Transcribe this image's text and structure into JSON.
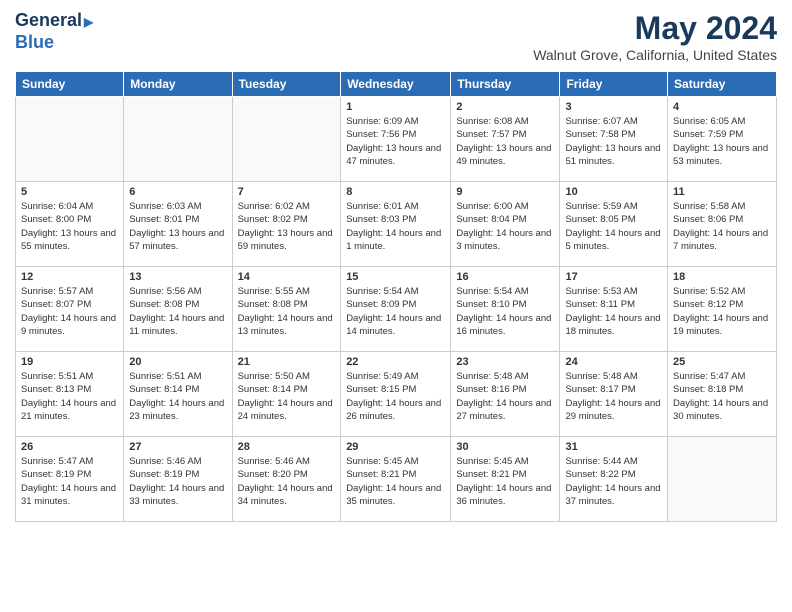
{
  "header": {
    "logo_line1": "General",
    "logo_line2": "Blue",
    "month": "May 2024",
    "location": "Walnut Grove, California, United States"
  },
  "days_of_week": [
    "Sunday",
    "Monday",
    "Tuesday",
    "Wednesday",
    "Thursday",
    "Friday",
    "Saturday"
  ],
  "weeks": [
    [
      {
        "day": "",
        "empty": true
      },
      {
        "day": "",
        "empty": true
      },
      {
        "day": "",
        "empty": true
      },
      {
        "day": "1",
        "sunrise": "6:09 AM",
        "sunset": "7:56 PM",
        "daylight": "13 hours and 47 minutes."
      },
      {
        "day": "2",
        "sunrise": "6:08 AM",
        "sunset": "7:57 PM",
        "daylight": "13 hours and 49 minutes."
      },
      {
        "day": "3",
        "sunrise": "6:07 AM",
        "sunset": "7:58 PM",
        "daylight": "13 hours and 51 minutes."
      },
      {
        "day": "4",
        "sunrise": "6:05 AM",
        "sunset": "7:59 PM",
        "daylight": "13 hours and 53 minutes."
      }
    ],
    [
      {
        "day": "5",
        "sunrise": "6:04 AM",
        "sunset": "8:00 PM",
        "daylight": "13 hours and 55 minutes."
      },
      {
        "day": "6",
        "sunrise": "6:03 AM",
        "sunset": "8:01 PM",
        "daylight": "13 hours and 57 minutes."
      },
      {
        "day": "7",
        "sunrise": "6:02 AM",
        "sunset": "8:02 PM",
        "daylight": "13 hours and 59 minutes."
      },
      {
        "day": "8",
        "sunrise": "6:01 AM",
        "sunset": "8:03 PM",
        "daylight": "14 hours and 1 minute."
      },
      {
        "day": "9",
        "sunrise": "6:00 AM",
        "sunset": "8:04 PM",
        "daylight": "14 hours and 3 minutes."
      },
      {
        "day": "10",
        "sunrise": "5:59 AM",
        "sunset": "8:05 PM",
        "daylight": "14 hours and 5 minutes."
      },
      {
        "day": "11",
        "sunrise": "5:58 AM",
        "sunset": "8:06 PM",
        "daylight": "14 hours and 7 minutes."
      }
    ],
    [
      {
        "day": "12",
        "sunrise": "5:57 AM",
        "sunset": "8:07 PM",
        "daylight": "14 hours and 9 minutes."
      },
      {
        "day": "13",
        "sunrise": "5:56 AM",
        "sunset": "8:08 PM",
        "daylight": "14 hours and 11 minutes."
      },
      {
        "day": "14",
        "sunrise": "5:55 AM",
        "sunset": "8:08 PM",
        "daylight": "14 hours and 13 minutes."
      },
      {
        "day": "15",
        "sunrise": "5:54 AM",
        "sunset": "8:09 PM",
        "daylight": "14 hours and 14 minutes."
      },
      {
        "day": "16",
        "sunrise": "5:54 AM",
        "sunset": "8:10 PM",
        "daylight": "14 hours and 16 minutes."
      },
      {
        "day": "17",
        "sunrise": "5:53 AM",
        "sunset": "8:11 PM",
        "daylight": "14 hours and 18 minutes."
      },
      {
        "day": "18",
        "sunrise": "5:52 AM",
        "sunset": "8:12 PM",
        "daylight": "14 hours and 19 minutes."
      }
    ],
    [
      {
        "day": "19",
        "sunrise": "5:51 AM",
        "sunset": "8:13 PM",
        "daylight": "14 hours and 21 minutes."
      },
      {
        "day": "20",
        "sunrise": "5:51 AM",
        "sunset": "8:14 PM",
        "daylight": "14 hours and 23 minutes."
      },
      {
        "day": "21",
        "sunrise": "5:50 AM",
        "sunset": "8:14 PM",
        "daylight": "14 hours and 24 minutes."
      },
      {
        "day": "22",
        "sunrise": "5:49 AM",
        "sunset": "8:15 PM",
        "daylight": "14 hours and 26 minutes."
      },
      {
        "day": "23",
        "sunrise": "5:48 AM",
        "sunset": "8:16 PM",
        "daylight": "14 hours and 27 minutes."
      },
      {
        "day": "24",
        "sunrise": "5:48 AM",
        "sunset": "8:17 PM",
        "daylight": "14 hours and 29 minutes."
      },
      {
        "day": "25",
        "sunrise": "5:47 AM",
        "sunset": "8:18 PM",
        "daylight": "14 hours and 30 minutes."
      }
    ],
    [
      {
        "day": "26",
        "sunrise": "5:47 AM",
        "sunset": "8:19 PM",
        "daylight": "14 hours and 31 minutes."
      },
      {
        "day": "27",
        "sunrise": "5:46 AM",
        "sunset": "8:19 PM",
        "daylight": "14 hours and 33 minutes."
      },
      {
        "day": "28",
        "sunrise": "5:46 AM",
        "sunset": "8:20 PM",
        "daylight": "14 hours and 34 minutes."
      },
      {
        "day": "29",
        "sunrise": "5:45 AM",
        "sunset": "8:21 PM",
        "daylight": "14 hours and 35 minutes."
      },
      {
        "day": "30",
        "sunrise": "5:45 AM",
        "sunset": "8:21 PM",
        "daylight": "14 hours and 36 minutes."
      },
      {
        "day": "31",
        "sunrise": "5:44 AM",
        "sunset": "8:22 PM",
        "daylight": "14 hours and 37 minutes."
      },
      {
        "day": "",
        "empty": true
      }
    ]
  ]
}
